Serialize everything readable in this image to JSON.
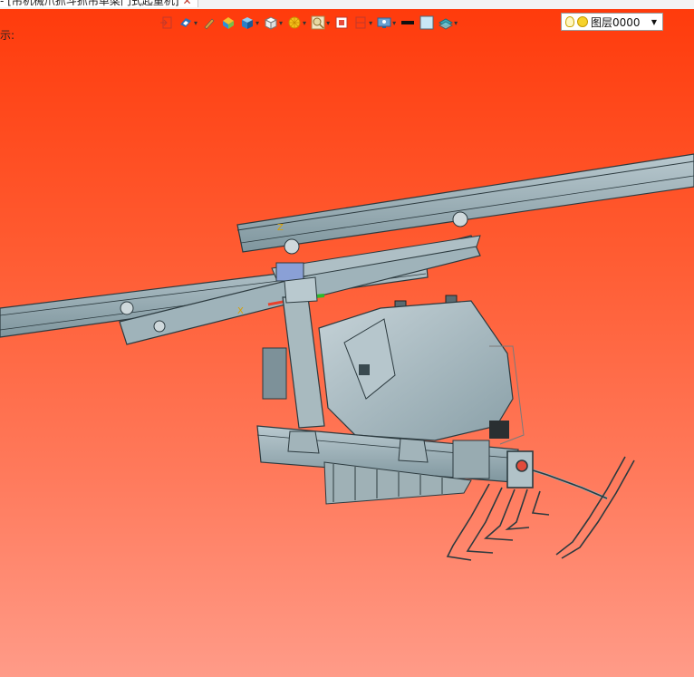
{
  "window": {
    "tab_title": "- [吊机械爪抓斗抓吊单梁门式起重机]",
    "tab_close": "✕"
  },
  "viewport": {
    "prompt": "示:",
    "background_top": "#ff3b0c",
    "background_bottom": "#ff9b88"
  },
  "toolbar": {
    "items": [
      {
        "icon": "exit-icon"
      },
      {
        "icon": "view-icon"
      },
      {
        "icon": "pen-icon"
      },
      {
        "icon": "material-icon"
      },
      {
        "icon": "cube-shaded-icon"
      },
      {
        "icon": "cube-white-icon"
      },
      {
        "icon": "sun-icon"
      },
      {
        "icon": "zoom-icon"
      },
      {
        "icon": "snapshot-icon"
      },
      {
        "icon": "section-icon"
      },
      {
        "icon": "display-icon"
      },
      {
        "icon": "line-color-icon"
      },
      {
        "icon": "fill-color-icon"
      },
      {
        "icon": "layer-stack-icon"
      }
    ],
    "layer_select": {
      "value": "图层0000"
    }
  }
}
